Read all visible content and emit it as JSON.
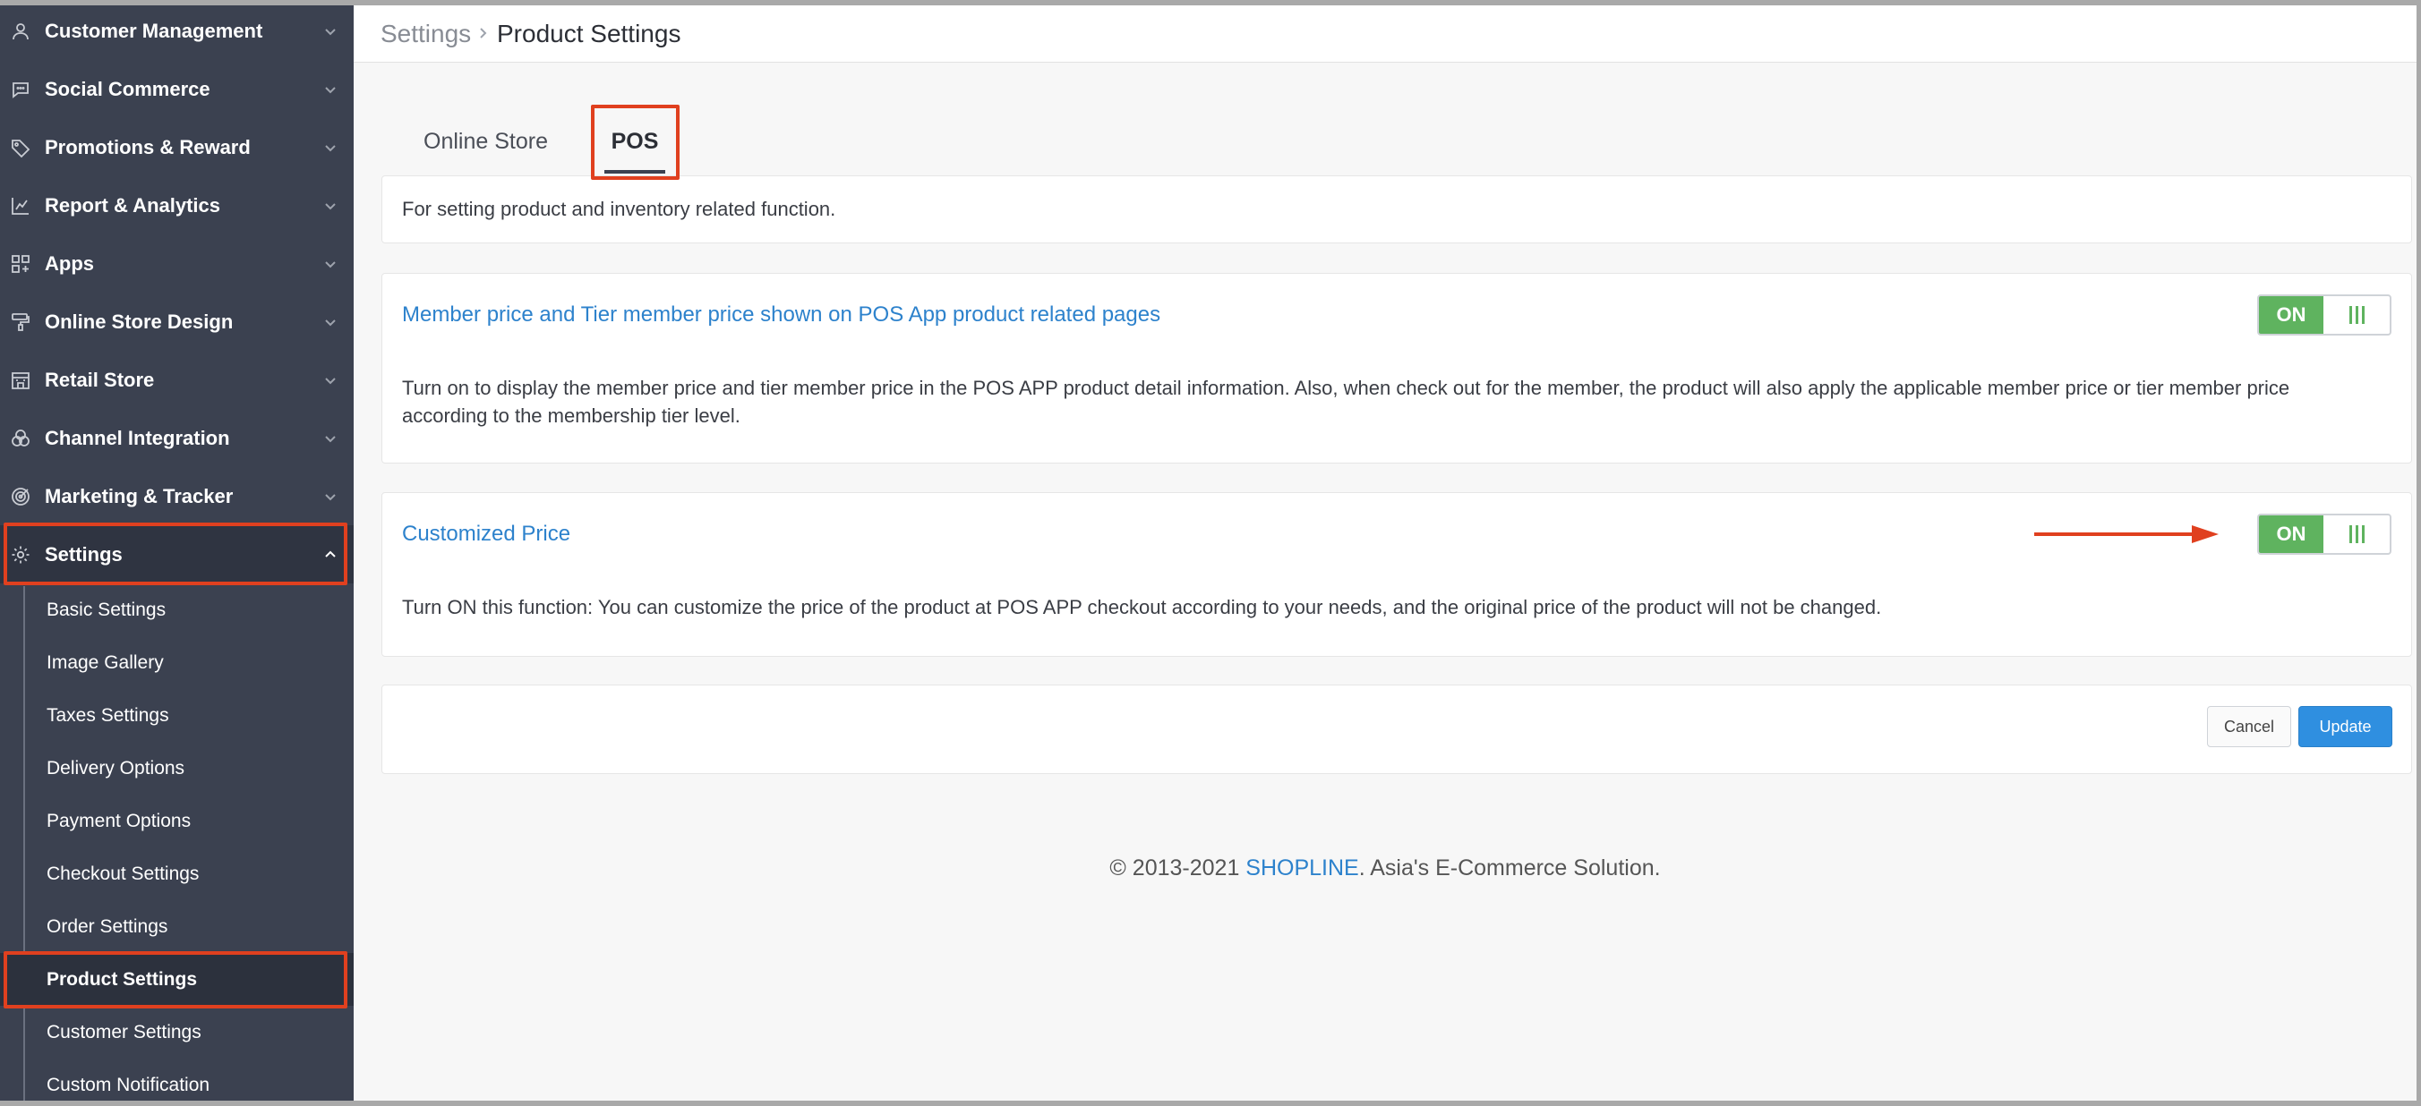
{
  "sidebar": {
    "items": [
      {
        "label": "Customer Management",
        "icon": "user-icon"
      },
      {
        "label": "Social Commerce",
        "icon": "chat-bubble-icon"
      },
      {
        "label": "Promotions & Reward",
        "icon": "tag-icon"
      },
      {
        "label": "Report & Analytics",
        "icon": "chart-icon"
      },
      {
        "label": "Apps",
        "icon": "apps-grid-icon"
      },
      {
        "label": "Online Store Design",
        "icon": "paint-roller-icon"
      },
      {
        "label": "Retail Store",
        "icon": "store-icon"
      },
      {
        "label": "Channel Integration",
        "icon": "circles-icon"
      },
      {
        "label": "Marketing & Tracker",
        "icon": "target-icon"
      },
      {
        "label": "Settings",
        "icon": "gear-icon"
      }
    ],
    "sub_items": [
      "Basic Settings",
      "Image Gallery",
      "Taxes Settings",
      "Delivery Options",
      "Payment Options",
      "Checkout Settings",
      "Order Settings",
      "Product Settings",
      "Customer Settings",
      "Custom Notification"
    ]
  },
  "header": {
    "breadcrumb_parent": "Settings",
    "breadcrumb_current": "Product Settings"
  },
  "tabs": [
    {
      "label": "Online Store"
    },
    {
      "label": "POS"
    }
  ],
  "intro": "For setting product and inventory related function.",
  "settings": [
    {
      "title": "Member price and Tier member price shown on POS App product related pages",
      "description": "Turn on to display the member price and tier member price in the POS APP product detail information. Also, when check out for the member, the product will also apply the applicable member price or tier member price according to the membership tier level.",
      "toggle": "ON"
    },
    {
      "title": "Customized Price",
      "description": "Turn ON this function: You can customize the price of the product at POS APP checkout according to your needs, and the original price of the product will not be changed.",
      "toggle": "ON"
    }
  ],
  "actions": {
    "cancel": "Cancel",
    "update": "Update"
  },
  "footer": {
    "prefix": "© 2013-2021 ",
    "brand": "SHOPLINE",
    "suffix": ". Asia's E-Commerce Solution."
  },
  "colors": {
    "sidebar_bg": "#3b4150",
    "accent_blue": "#2d82cc",
    "toggle_green": "#5fb35f",
    "annotation_red": "#e0401f",
    "update_button": "#2f8fe0"
  }
}
